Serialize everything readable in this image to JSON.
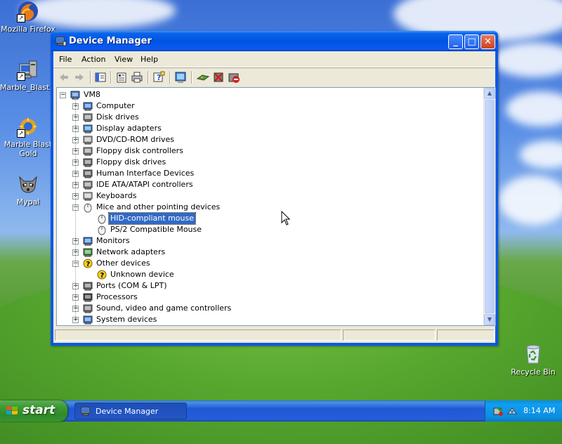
{
  "desktop": {
    "icons": [
      {
        "label": "Mozilla Firefox",
        "icon": "firefox-icon"
      },
      {
        "label": "Marble_Blast...",
        "icon": "computer-setup-icon"
      },
      {
        "label": "Marble Blast Gold",
        "icon": "marble-blast-icon"
      },
      {
        "label": "Mypal",
        "icon": "raccoon-icon"
      },
      {
        "label": "Recycle Bin",
        "icon": "recycle-bin-icon"
      }
    ]
  },
  "window": {
    "title": "Device Manager",
    "buttons": {
      "minimize": "_",
      "maximize": "□",
      "close": "✕"
    },
    "menu": [
      "File",
      "Action",
      "View",
      "Help"
    ]
  },
  "tree": {
    "root": "VM8",
    "items": [
      {
        "label": "Computer",
        "icon": "computer-icon",
        "expanded": false
      },
      {
        "label": "Disk drives",
        "icon": "disk-drive-icon",
        "expanded": false
      },
      {
        "label": "Display adapters",
        "icon": "display-adapter-icon",
        "expanded": false
      },
      {
        "label": "DVD/CD-ROM drives",
        "icon": "cdrom-icon",
        "expanded": false
      },
      {
        "label": "Floppy disk controllers",
        "icon": "floppy-controller-icon",
        "expanded": false
      },
      {
        "label": "Floppy disk drives",
        "icon": "floppy-drive-icon",
        "expanded": false
      },
      {
        "label": "Human Interface Devices",
        "icon": "hid-icon",
        "expanded": false
      },
      {
        "label": "IDE ATA/ATAPI controllers",
        "icon": "ide-controller-icon",
        "expanded": false
      },
      {
        "label": "Keyboards",
        "icon": "keyboard-icon",
        "expanded": false
      },
      {
        "label": "Mice and other pointing devices",
        "icon": "mouse-icon",
        "expanded": true,
        "children": [
          {
            "label": "HID-compliant mouse",
            "icon": "mouse-icon",
            "selected": true
          },
          {
            "label": "PS/2 Compatible Mouse",
            "icon": "mouse-icon",
            "selected": false
          }
        ]
      },
      {
        "label": "Monitors",
        "icon": "monitor-icon",
        "expanded": false
      },
      {
        "label": "Network adapters",
        "icon": "network-adapter-icon",
        "expanded": false
      },
      {
        "label": "Other devices",
        "icon": "unknown-device-icon",
        "expanded": true,
        "children": [
          {
            "label": "Unknown device",
            "icon": "warning-device-icon",
            "selected": false
          }
        ]
      },
      {
        "label": "Ports (COM & LPT)",
        "icon": "port-icon",
        "expanded": false
      },
      {
        "label": "Processors",
        "icon": "processor-icon",
        "expanded": false
      },
      {
        "label": "Sound, video and game controllers",
        "icon": "sound-icon",
        "expanded": false
      },
      {
        "label": "System devices",
        "icon": "system-device-icon",
        "expanded": false
      }
    ]
  },
  "taskbar": {
    "start_label": "start",
    "task_label": "Device Manager",
    "clock": "8:14 AM"
  }
}
